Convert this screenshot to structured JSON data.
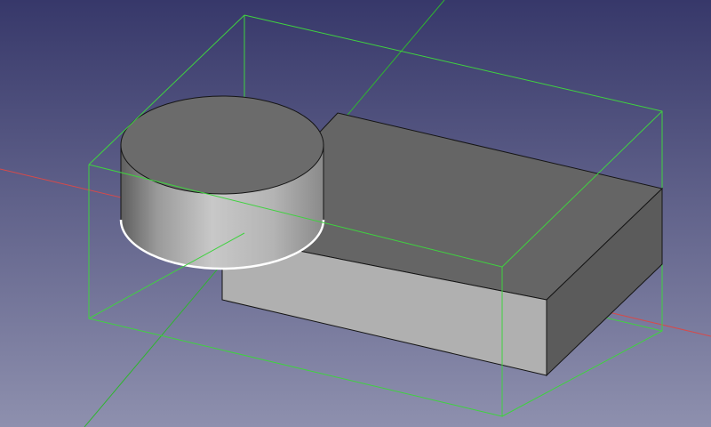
{
  "viewport": {
    "background_top": "#37386a",
    "background_bottom": "#8e90ae"
  },
  "axes": {
    "x_axis_color": "#d64a4a",
    "y_axis_color": "#2fb52f"
  },
  "bounding_box": {
    "color": "#3fd23f"
  },
  "objects": {
    "cylinder": {
      "top_color": "#6b6b6b",
      "side_dark": "#5e5e5e",
      "side_light": "#c8c8c8",
      "edge_color": "#151515",
      "selected_edge_color": "#ffffff"
    },
    "box": {
      "top_color": "#656565",
      "front_color": "#b0b0b0",
      "side_color": "#5b5b5b",
      "edge_color": "#151515"
    }
  }
}
